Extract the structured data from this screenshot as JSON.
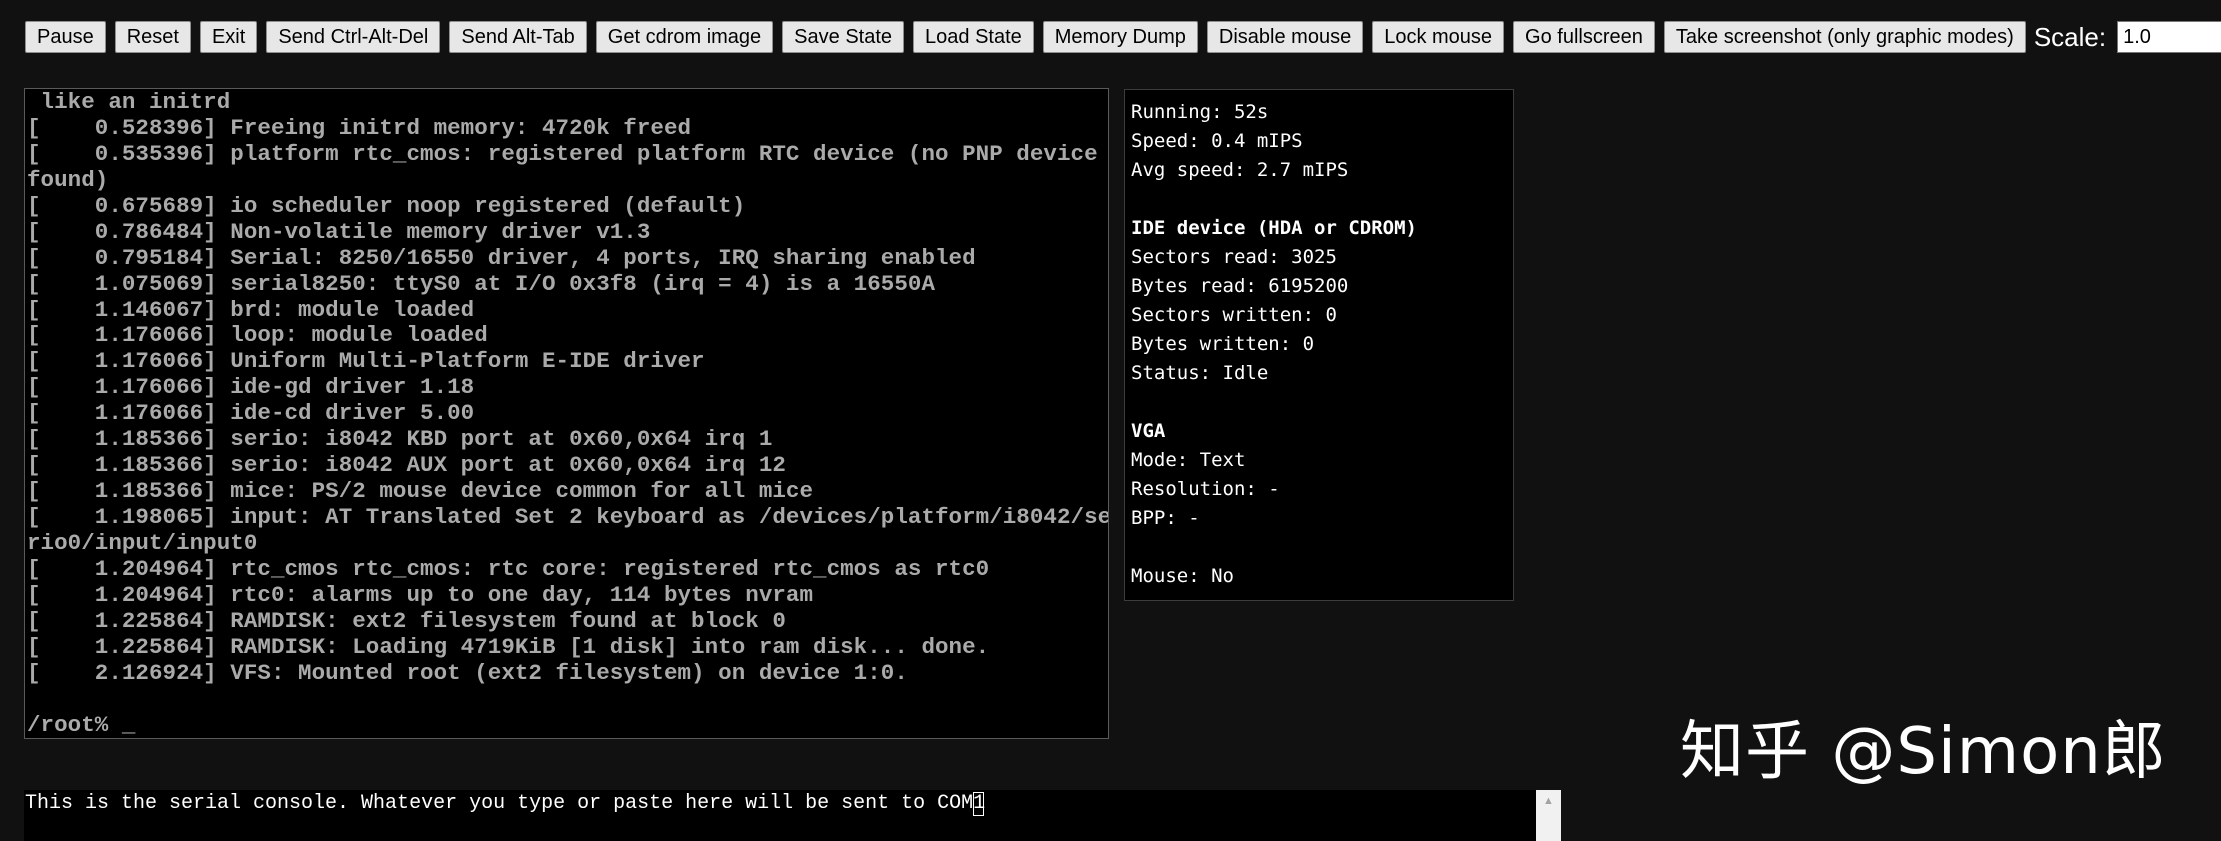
{
  "toolbar": {
    "buttons": [
      "Pause",
      "Reset",
      "Exit",
      "Send Ctrl-Alt-Del",
      "Send Alt-Tab",
      "Get cdrom image",
      "Save State",
      "Load State",
      "Memory Dump",
      "Disable mouse",
      "Lock mouse",
      "Go fullscreen",
      "Take screenshot (only graphic modes)"
    ],
    "scale_label": "Scale:",
    "scale_value": "1.0"
  },
  "screen": {
    "lines": [
      " like an initrd",
      "[    0.528396] Freeing initrd memory: 4720k freed",
      "[    0.535396] platform rtc_cmos: registered platform RTC device (no PNP device",
      "found)",
      "[    0.675689] io scheduler noop registered (default)",
      "[    0.786484] Non-volatile memory driver v1.3",
      "[    0.795184] Serial: 8250/16550 driver, 4 ports, IRQ sharing enabled",
      "[    1.075069] serial8250: ttyS0 at I/O 0x3f8 (irq = 4) is a 16550A",
      "[    1.146067] brd: module loaded",
      "[    1.176066] loop: module loaded",
      "[    1.176066] Uniform Multi-Platform E-IDE driver",
      "[    1.176066] ide-gd driver 1.18",
      "[    1.176066] ide-cd driver 5.00",
      "[    1.185366] serio: i8042 KBD port at 0x60,0x64 irq 1",
      "[    1.185366] serio: i8042 AUX port at 0x60,0x64 irq 12",
      "[    1.185366] mice: PS/2 mouse device common for all mice",
      "[    1.198065] input: AT Translated Set 2 keyboard as /devices/platform/i8042/se",
      "rio0/input/input0",
      "[    1.204964] rtc_cmos rtc_cmos: rtc core: registered rtc_cmos as rtc0",
      "[    1.204964] rtc0: alarms up to one day, 114 bytes nvram",
      "[    1.225864] RAMDISK: ext2 filesystem found at block 0",
      "[    1.225864] RAMDISK: Loading 4719KiB [1 disk] into ram disk... done.",
      "[    2.126924] VFS: Mounted root (ext2 filesystem) on device 1:0.",
      "",
      "/root% _"
    ]
  },
  "stats": {
    "running": "Running: 52s",
    "speed": "Speed: 0.4 mIPS",
    "avg_speed": "Avg speed: 2.7 mIPS",
    "ide_heading": "IDE device (HDA or CDROM)",
    "sectors_read": "Sectors read: 3025",
    "bytes_read": "Bytes read: 6195200",
    "sectors_written": "Sectors written: 0",
    "bytes_written": "Bytes written: 0",
    "status": "Status: Idle",
    "vga_heading": "VGA",
    "mode": "Mode: Text",
    "resolution": "Resolution: -",
    "bpp": "BPP: -",
    "mouse": "Mouse: No"
  },
  "watermark": "知乎 @Simon郎",
  "serial": {
    "text": "This is the serial console. Whatever you type or paste here will be sent to COM1"
  }
}
